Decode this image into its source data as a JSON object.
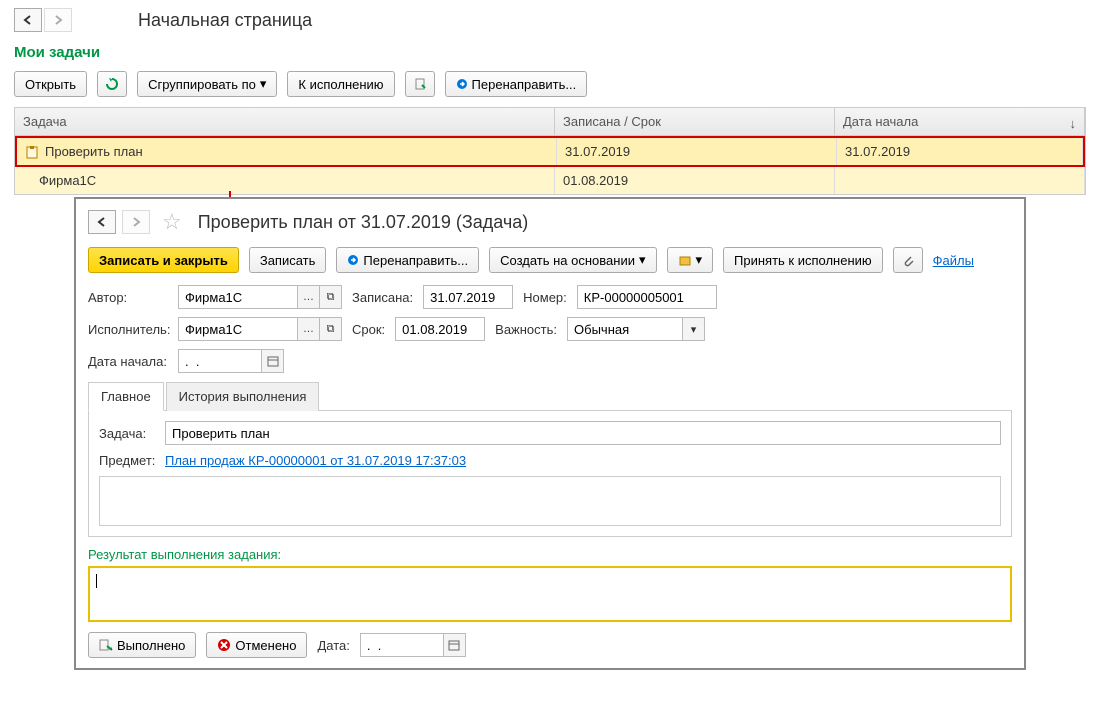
{
  "page_title": "Начальная страница",
  "section": "Мои задачи",
  "toolbar": {
    "open": "Открыть",
    "group_by": "Сгруппировать по",
    "to_execution": "К исполнению",
    "redirect": "Перенаправить..."
  },
  "table": {
    "columns": {
      "task": "Задача",
      "recorded": "Записана / Срок",
      "start": "Дата начала"
    },
    "rows": [
      {
        "task": "Проверить план",
        "recorded": "31.07.2019",
        "start": "31.07.2019"
      },
      {
        "task": "Фирма1С",
        "recorded": "01.08.2019",
        "start": ""
      }
    ]
  },
  "dialog": {
    "title": "Проверить план от 31.07.2019 (Задача)",
    "buttons": {
      "save_close": "Записать и закрыть",
      "save": "Записать",
      "redirect": "Перенаправить...",
      "create_based": "Создать на основании",
      "accept": "Принять к исполнению",
      "files": "Файлы"
    },
    "fields": {
      "author_label": "Автор:",
      "author": "Фирма1С",
      "recorded_label": "Записана:",
      "recorded": "31.07.2019",
      "number_label": "Номер:",
      "number": "КР-00000005001",
      "executor_label": "Исполнитель:",
      "executor": "Фирма1С",
      "deadline_label": "Срок:",
      "deadline": "01.08.2019",
      "importance_label": "Важность:",
      "importance": "Обычная",
      "start_label": "Дата начала:",
      "start": ".  ."
    },
    "tabs": {
      "main": "Главное",
      "history": "История выполнения"
    },
    "content": {
      "task_label": "Задача:",
      "task": "Проверить план",
      "subject_label": "Предмет:",
      "subject": "План продаж КР-00000001 от 31.07.2019 17:37:03"
    },
    "result_label": "Результат выполнения задания:",
    "bottom": {
      "done": "Выполнено",
      "cancel": "Отменено",
      "date_label": "Дата:",
      "date": ".  ."
    }
  }
}
